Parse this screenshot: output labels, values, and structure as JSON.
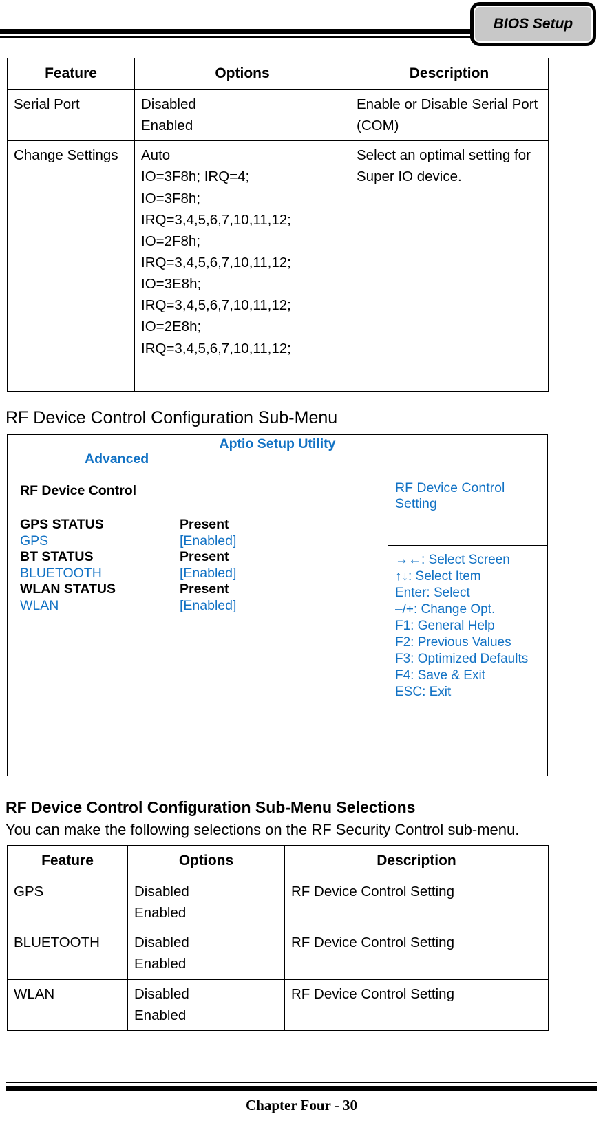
{
  "header": {
    "tab_label": "BIOS Setup"
  },
  "table_serial_port": {
    "columns": [
      "Feature",
      "Options",
      "Description"
    ],
    "rows": [
      {
        "feature": "Serial Port",
        "options": [
          "Disabled",
          "Enabled"
        ],
        "description": "Enable or Disable Serial Port (COM)"
      },
      {
        "feature": "Change Settings",
        "options": [
          "Auto",
          "IO=3F8h; IRQ=4;",
          "IO=3F8h;",
          "IRQ=3,4,5,6,7,10,11,12;",
          "IO=2F8h;",
          "IRQ=3,4,5,6,7,10,11,12;",
          "IO=3E8h;",
          "IRQ=3,4,5,6,7,10,11,12;",
          "IO=2E8h;",
          "IRQ=3,4,5,6,7,10,11,12;"
        ],
        "description": "Select an optimal setting for Super IO device."
      }
    ]
  },
  "heading_submenu": "RF Device Control Configuration Sub-Menu",
  "bios_screen": {
    "app_title": "Aptio Setup Utility",
    "active_menu": "Advanced",
    "section_title": "RF Device Control",
    "items": [
      {
        "label": "GPS STATUS",
        "value": "Present",
        "kind": "status"
      },
      {
        "label": "GPS",
        "value": "[Enabled]",
        "kind": "option"
      },
      {
        "label": "BT STATUS",
        "value": "Present",
        "kind": "status"
      },
      {
        "label": "BLUETOOTH",
        "value": "[Enabled]",
        "kind": "option"
      },
      {
        "label": "WLAN STATUS",
        "value": "Present",
        "kind": "status"
      },
      {
        "label": "WLAN",
        "value": "[Enabled]",
        "kind": "option"
      }
    ],
    "help_text": "RF Device Control Setting",
    "key_legend": [
      "→←: Select Screen",
      "↑↓: Select Item",
      "Enter: Select",
      "–/+: Change Opt.",
      "F1: General Help",
      "F2: Previous Values",
      "F3: Optimized Defaults",
      "F4: Save & Exit",
      "ESC: Exit"
    ]
  },
  "heading_selections": "RF Device Control Configuration Sub-Menu Selections",
  "intro_selections": "You can make the following selections on the RF Security Control sub-menu.",
  "table_rf_selections": {
    "columns": [
      "Feature",
      "Options",
      "Description"
    ],
    "rows": [
      {
        "feature": "GPS",
        "options": [
          "Disabled",
          "Enabled"
        ],
        "description": "RF Device Control Setting"
      },
      {
        "feature": "BLUETOOTH",
        "options": [
          "Disabled",
          "Enabled"
        ],
        "description": "RF Device Control Setting"
      },
      {
        "feature": "WLAN",
        "options": [
          "Disabled",
          "Enabled"
        ],
        "description": "RF Device Control Setting"
      }
    ]
  },
  "footer": {
    "text": "Chapter Four - 30"
  },
  "colors": {
    "bios_blue": "#1272c4",
    "tab_fill": "#c8c8c8",
    "rule": "#000000"
  }
}
